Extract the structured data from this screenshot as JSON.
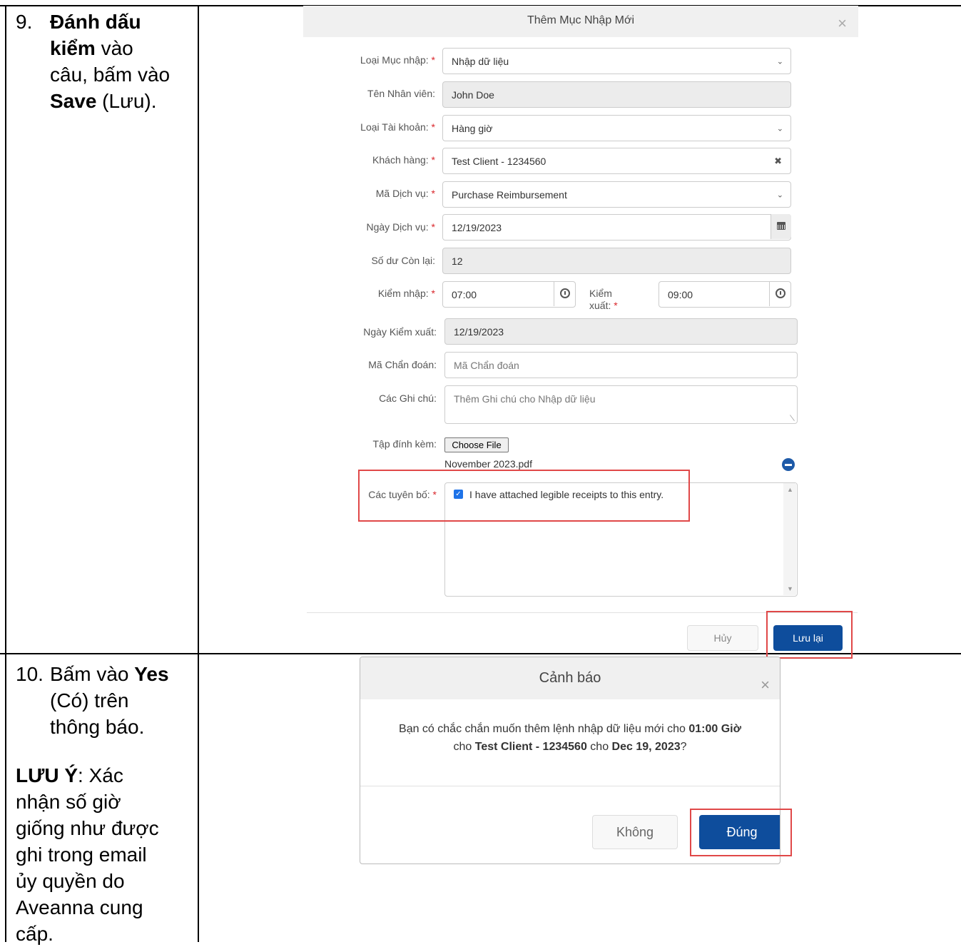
{
  "step9": {
    "num": "9.",
    "line1_bold": "Đánh dấu",
    "line2_bold": "kiểm",
    "line2_rest": " vào",
    "line3": "câu, bấm vào",
    "line4_bold": "Save",
    "line4_rest": " (Lưu)."
  },
  "step10": {
    "num": "10.",
    "line1_pre": "Bấm vào ",
    "line1_bold": "Yes",
    "line2": "(Có) trên",
    "line3": "thông báo.",
    "note_bold": "LƯU Ý",
    "note_rest": ": Xác",
    "note_lines": [
      "nhận số giờ",
      "giống như được",
      "ghi trong email",
      "ủy quyền do",
      "Aveanna cung",
      "cấp."
    ]
  },
  "entry_modal": {
    "title": "Thêm Mục Nhập Mới",
    "close": "×",
    "required_mark": "*",
    "fields": {
      "entry_type": {
        "label": "Loại Mục nhập:",
        "value": "Nhập dữ liệu"
      },
      "employee_name": {
        "label": "Tên Nhân viên:",
        "value": "John Doe"
      },
      "account_type": {
        "label": "Loại Tài khoản:",
        "value": "Hàng giờ"
      },
      "client": {
        "label": "Khách hàng:",
        "value": "Test Client - 1234560"
      },
      "service_code": {
        "label": "Mã Dịch vụ:",
        "value": "Purchase Reimbursement"
      },
      "service_date": {
        "label": "Ngày Dịch vụ:",
        "value": "12/19/2023"
      },
      "balance": {
        "label": "Số dư Còn lại:",
        "value": "12"
      },
      "check_in": {
        "label": "Kiểm nhập:",
        "value": "07:00"
      },
      "check_out": {
        "label_line1": "Kiểm",
        "label_line2": "xuất:",
        "value": "09:00"
      },
      "checkout_date": {
        "label": "Ngày Kiểm xuất:",
        "value": "12/19/2023"
      },
      "diagnosis_code": {
        "label": "Mã Chẩn đoán:",
        "placeholder": "Mã Chẩn đoán"
      },
      "notes": {
        "label": "Các Ghi chú:",
        "placeholder": "Thêm Ghi chú cho Nhập dữ liệu"
      },
      "attachment": {
        "label": "Tập đính kèm:",
        "button": "Choose File",
        "file_name": "November 2023.pdf"
      },
      "declarations": {
        "label": "Các tuyên bố:",
        "checkbox_text": "I have attached legible receipts to this entry.",
        "checked": true
      }
    },
    "cancel_label": "Hủy",
    "save_label": "Lưu lại"
  },
  "confirm_modal": {
    "title": "Cảnh báo",
    "close": "×",
    "msg_part1": "Bạn có chắc chắn muốn thêm lệnh nhập dữ liệu mới cho ",
    "msg_hours": "01:00 Giờ",
    "msg_part2": "cho ",
    "msg_client": "Test Client - 1234560",
    "msg_part3": " cho ",
    "msg_date": "Dec 19, 2023",
    "msg_end": "?",
    "no_label": "Không",
    "yes_label": "Đúng"
  }
}
